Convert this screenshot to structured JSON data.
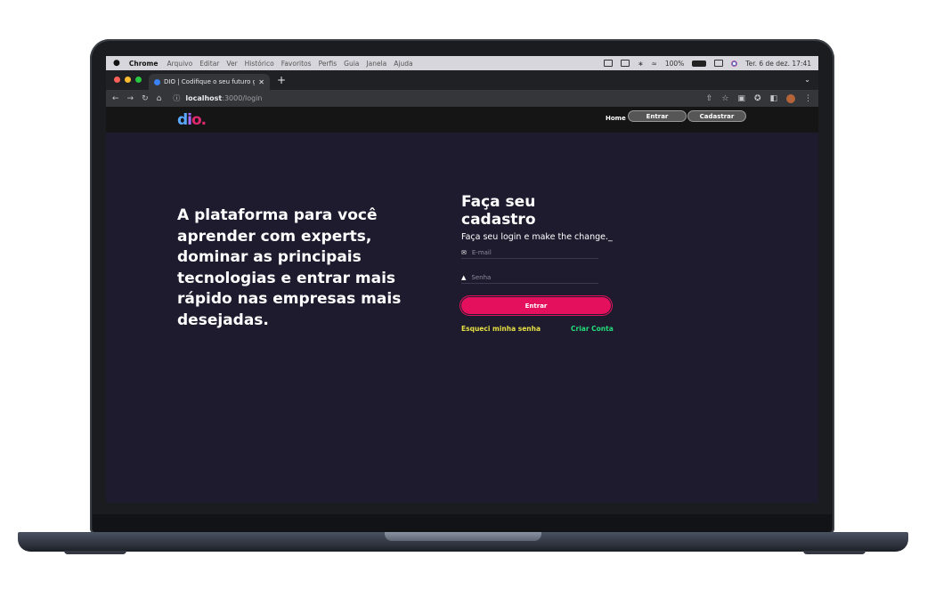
{
  "menubar": {
    "app": "Chrome",
    "menus": [
      "Arquivo",
      "Editar",
      "Ver",
      "Histórico",
      "Favoritos",
      "Perfis",
      "Guia",
      "Janela",
      "Ajuda"
    ],
    "battery": "100%",
    "datetime": "Ter. 6 de dez.  17:41"
  },
  "browser": {
    "tab_title": "DIO | Codifique o seu futuro gl",
    "url_host": "localhost",
    "url_path": ":3000/login",
    "traffic_colors": [
      "#ff5f57",
      "#febc2e",
      "#28c840"
    ]
  },
  "site": {
    "logo": {
      "d": "d",
      "i": "i",
      "o": "o."
    },
    "nav": {
      "home": "Home",
      "entrar": "Entrar",
      "cadastrar": "Cadastrar"
    }
  },
  "main": {
    "headline": "A plataforma para você aprender com experts, dominar as principais tecnologias e entrar mais rápido nas empresas mais desejadas.",
    "form": {
      "title": "Faça seu cadastro",
      "subtitle": "Faça seu login e make the change._",
      "email_placeholder": "E-mail",
      "password_placeholder": "Senha",
      "submit_label": "Entrar",
      "forgot_label": "Esqueci minha senha",
      "create_label": "Criar Conta"
    }
  },
  "colors": {
    "background": "#1f1b2e",
    "accent": "#e4105d",
    "forgot": "#e5e044",
    "create": "#23dd7a"
  }
}
